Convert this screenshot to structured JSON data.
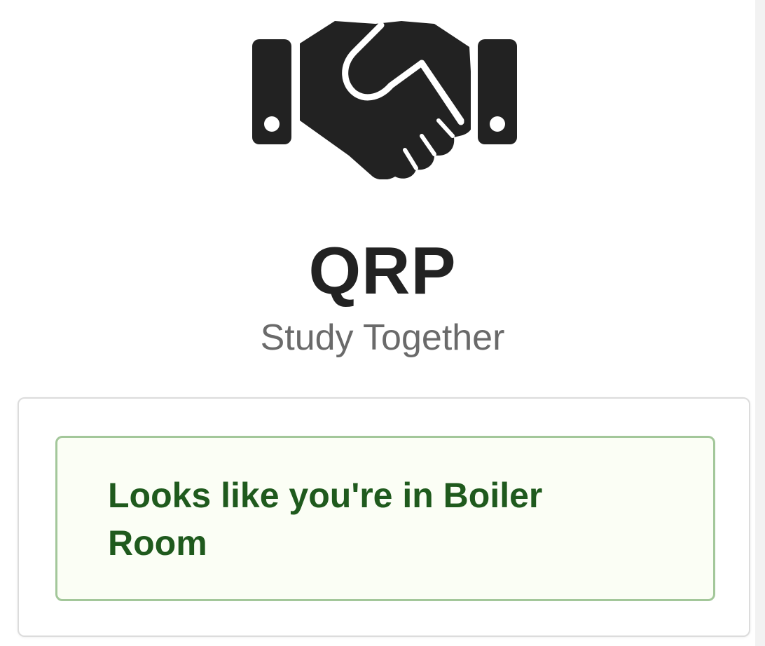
{
  "header": {
    "logo_icon": "handshake-icon",
    "app_name": "QRP",
    "tagline": "Study Together"
  },
  "status_card": {
    "message": "Looks like you're in Boiler Room"
  },
  "colors": {
    "icon": "#222222",
    "title": "#222222",
    "tagline": "#6a6a6a",
    "alert_background": "#fbfef5",
    "alert_border": "#a3c79a",
    "alert_text": "#1f5a1d"
  }
}
